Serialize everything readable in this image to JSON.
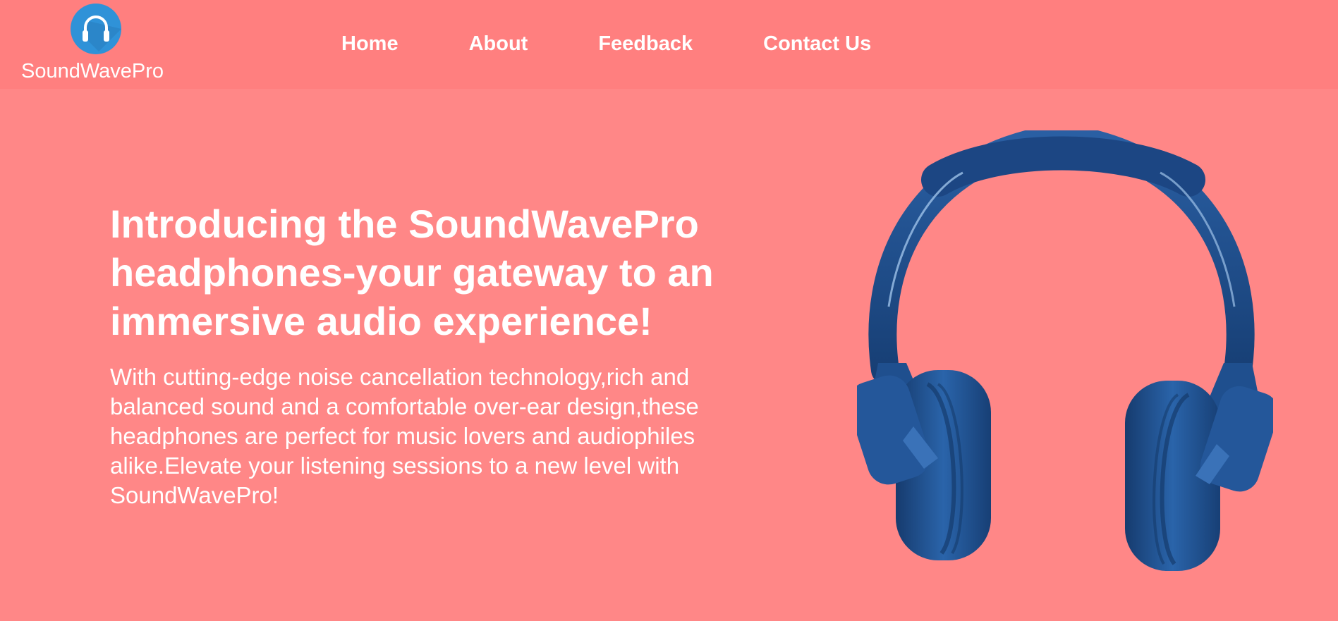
{
  "brand": {
    "name": "SoundWavePro",
    "logo_icon": "headphones-icon",
    "logo_color": "#2f92d8"
  },
  "nav": {
    "items": [
      {
        "label": "Home"
      },
      {
        "label": "About"
      },
      {
        "label": "Feedback"
      },
      {
        "label": "Contact Us"
      }
    ]
  },
  "hero": {
    "title": "Introducing the SoundWavePro headphones-your gateway to an immersive audio experience!",
    "description": "With cutting-edge noise cancellation technology,rich and balanced sound and a comfortable over-ear design,these headphones are perfect for music lovers and audiophiles alike.Elevate your listening sessions to a new level with SoundWavePro!",
    "image_icon": "headphones-image"
  },
  "colors": {
    "header_bg": "#ff7f7f",
    "page_bg": "#ff8787",
    "headphone_blue": "#1f4f8e",
    "text": "#ffffff"
  }
}
